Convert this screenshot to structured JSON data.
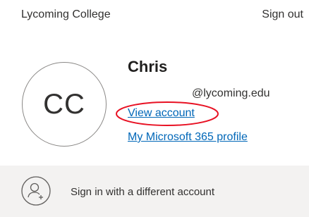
{
  "header": {
    "organization": "Lycoming College",
    "sign_out_label": "Sign out"
  },
  "account": {
    "initials": "CC",
    "name": "Chris",
    "email": "@lycoming.edu",
    "view_account_label": "View account",
    "profile_link_label": "My Microsoft 365 profile"
  },
  "footer": {
    "other_account_label": "Sign in with a different account",
    "other_account_icon": "person-add-icon"
  },
  "colors": {
    "link": "#0067b8",
    "highlight_annotation": "#e81123",
    "footer_background": "#f3f2f1"
  }
}
